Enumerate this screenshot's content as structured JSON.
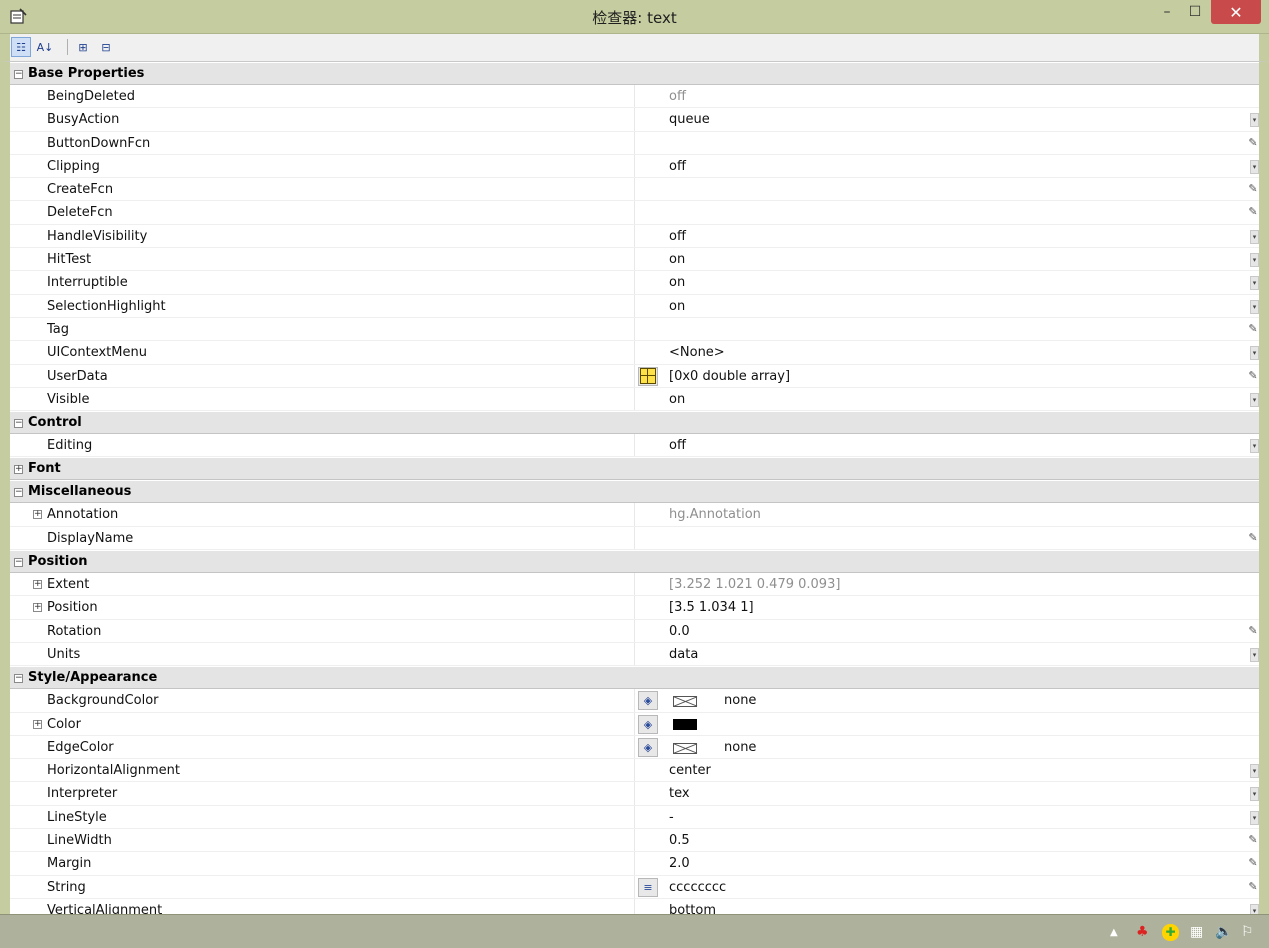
{
  "window": {
    "title": "检查器: text",
    "minimize_glyph": "–",
    "maximize_glyph": "☐",
    "close_glyph": "✕"
  },
  "toolbar": {
    "buttons": [
      {
        "name": "categorized-view-icon",
        "glyph": "☷",
        "active": true
      },
      {
        "name": "alphabetical-sort-icon",
        "glyph": "A↓",
        "active": false
      },
      {
        "name": "expand-all-icon",
        "glyph": "⊞",
        "active": false
      },
      {
        "name": "collapse-all-icon",
        "glyph": "⊟",
        "active": false
      }
    ]
  },
  "categories": [
    {
      "label": "Base Properties",
      "expanded": true,
      "rows": [
        {
          "name": "BeingDeleted",
          "value": "off",
          "readonly": true,
          "ctrl": ""
        },
        {
          "name": "BusyAction",
          "value": "queue",
          "ctrl": "dropdown"
        },
        {
          "name": "ButtonDownFcn",
          "value": "",
          "ctrl": "pencil"
        },
        {
          "name": "Clipping",
          "value": "off",
          "ctrl": "dropdown"
        },
        {
          "name": "CreateFcn",
          "value": "",
          "ctrl": "pencil"
        },
        {
          "name": "DeleteFcn",
          "value": "",
          "ctrl": "pencil"
        },
        {
          "name": "HandleVisibility",
          "value": "off",
          "ctrl": "dropdown"
        },
        {
          "name": "HitTest",
          "value": "on",
          "ctrl": "dropdown"
        },
        {
          "name": "Interruptible",
          "value": "on",
          "ctrl": "dropdown"
        },
        {
          "name": "SelectionHighlight",
          "value": "on",
          "ctrl": "dropdown"
        },
        {
          "name": "Tag",
          "value": "",
          "ctrl": "pencil"
        },
        {
          "name": "UIContextMenu",
          "value": "<None>",
          "ctrl": "dropdown"
        },
        {
          "name": "UserData",
          "value": "[0x0  double array]",
          "ctrl": "pencil",
          "editbtn": "grid"
        },
        {
          "name": "Visible",
          "value": "on",
          "ctrl": "dropdown"
        }
      ]
    },
    {
      "label": "Control",
      "expanded": true,
      "rows": [
        {
          "name": "Editing",
          "value": "off",
          "ctrl": "dropdown"
        }
      ]
    },
    {
      "label": "Font",
      "expanded": false,
      "rows": []
    },
    {
      "label": "Miscellaneous",
      "expanded": true,
      "rows": [
        {
          "name": "Annotation",
          "value": "hg.Annotation",
          "readonly": true,
          "expandable": true,
          "ctrl": ""
        },
        {
          "name": "DisplayName",
          "value": "",
          "ctrl": "pencil"
        }
      ]
    },
    {
      "label": "Position",
      "expanded": true,
      "rows": [
        {
          "name": "Extent",
          "value": "[3.252 1.021 0.479 0.093]",
          "readonly": true,
          "expandable": true,
          "ctrl": ""
        },
        {
          "name": "Position",
          "value": "[3.5 1.034 1]",
          "expandable": true,
          "ctrl": ""
        },
        {
          "name": "Rotation",
          "value": "0.0",
          "ctrl": "pencil"
        },
        {
          "name": "Units",
          "value": "data",
          "ctrl": "dropdown"
        }
      ]
    },
    {
      "label": "Style/Appearance",
      "expanded": true,
      "rows": [
        {
          "name": "BackgroundColor",
          "value": "none",
          "ctrl": "",
          "editbtn": "paint",
          "swatch": "none"
        },
        {
          "name": "Color",
          "value": "",
          "expandable": true,
          "ctrl": "",
          "editbtn": "paint",
          "swatch": "black"
        },
        {
          "name": "EdgeColor",
          "value": "none",
          "ctrl": "",
          "editbtn": "paint",
          "swatch": "none"
        },
        {
          "name": "HorizontalAlignment",
          "value": "center",
          "ctrl": "dropdown"
        },
        {
          "name": "Interpreter",
          "value": "tex",
          "ctrl": "dropdown"
        },
        {
          "name": "LineStyle",
          "value": "-",
          "ctrl": "dropdown"
        },
        {
          "name": "LineWidth",
          "value": "0.5",
          "ctrl": "pencil"
        },
        {
          "name": "Margin",
          "value": "2.0",
          "ctrl": "pencil"
        },
        {
          "name": "String",
          "value": "cccccccc",
          "ctrl": "pencil",
          "editbtn": "text"
        },
        {
          "name": "VerticalAlignment",
          "value": "bottom",
          "ctrl": "dropdown"
        }
      ]
    }
  ],
  "tray": [
    {
      "name": "show-hidden-icons-icon",
      "glyph": "▲"
    },
    {
      "name": "qq-icon",
      "glyph": "♣"
    },
    {
      "name": "update-icon",
      "glyph": "✚"
    },
    {
      "name": "network-icon",
      "glyph": "▦"
    },
    {
      "name": "volume-icon",
      "glyph": "🔈"
    },
    {
      "name": "action-center-icon",
      "glyph": "⚐"
    }
  ],
  "colors": {
    "titlebar": "#c5cda0",
    "close_button": "#c94a4a",
    "category_bg": "#e4e4e4",
    "readonly_text": "#8f8f8f"
  }
}
